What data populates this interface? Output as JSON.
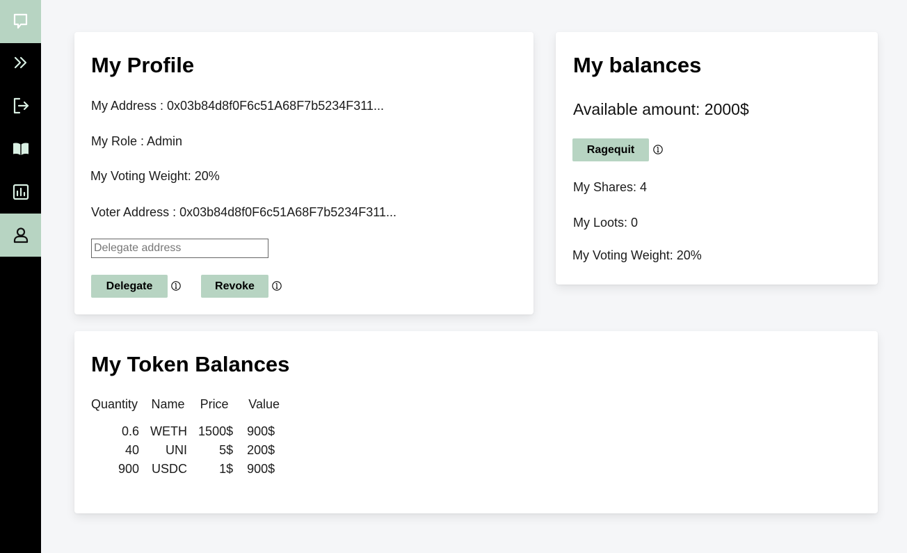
{
  "sidebar": {
    "items": [
      {
        "icon": "chat-icon",
        "active": true
      },
      {
        "icon": "chevrons-right-icon",
        "active": false
      },
      {
        "icon": "logout-icon",
        "active": false
      },
      {
        "icon": "book-icon",
        "active": false
      },
      {
        "icon": "chart-icon",
        "active": false
      },
      {
        "icon": "user-icon",
        "active": true
      }
    ]
  },
  "profile": {
    "title": "My Profile",
    "address": "My Address : 0x03b84d8f0F6c51A68F7b5234F311...",
    "role": "My Role : Admin",
    "voting_weight": "My Voting Weight: 20%",
    "voter_address": "Voter Address : 0x03b84d8f0F6c51A68F7b5234F311...",
    "delegate_placeholder": "Delegate address",
    "delegate_value": "",
    "delegate_label": "Delegate",
    "revoke_label": "Revoke"
  },
  "balances": {
    "title": "My balances",
    "available": "Available amount: 2000$",
    "ragequit_label": "Ragequit",
    "shares": "My Shares: 4",
    "loots": "My Loots: 0",
    "voting_weight": "My Voting Weight: 20%"
  },
  "tokens": {
    "title": "My Token Balances",
    "headers": [
      "Quantity",
      "Name",
      "Price",
      "Value"
    ],
    "rows": [
      [
        "0.6",
        "WETH",
        "1500$",
        "900$"
      ],
      [
        "40",
        "UNI",
        "5$",
        "200$"
      ],
      [
        "900",
        "USDC",
        "1$",
        "900$"
      ]
    ]
  },
  "colors": {
    "accent": "#b7d4c2",
    "sidebar": "#000000",
    "background": "#f5f6f8"
  }
}
